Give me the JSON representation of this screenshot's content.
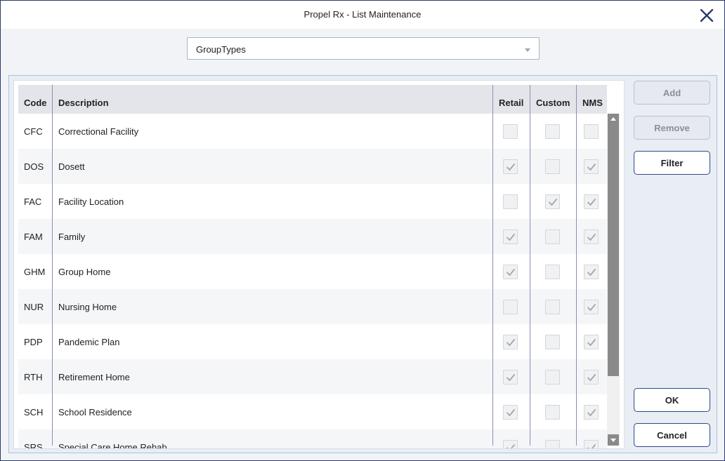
{
  "window": {
    "title": "Propel Rx - List Maintenance"
  },
  "list_selector": {
    "value": "GroupTypes"
  },
  "grid": {
    "columns": [
      "Code",
      "Description",
      "Retail",
      "Custom",
      "NMS"
    ],
    "rows": [
      {
        "code": "CFC",
        "description": "Correctional Facility",
        "retail": false,
        "custom": false,
        "nms": false
      },
      {
        "code": "DOS",
        "description": "Dosett",
        "retail": true,
        "custom": false,
        "nms": true
      },
      {
        "code": "FAC",
        "description": "Facility Location",
        "retail": false,
        "custom": true,
        "nms": true
      },
      {
        "code": "FAM",
        "description": "Family",
        "retail": true,
        "custom": false,
        "nms": true
      },
      {
        "code": "GHM",
        "description": "Group Home",
        "retail": true,
        "custom": false,
        "nms": true
      },
      {
        "code": "NUR",
        "description": "Nursing Home",
        "retail": false,
        "custom": false,
        "nms": true
      },
      {
        "code": "PDP",
        "description": "Pandemic Plan",
        "retail": true,
        "custom": false,
        "nms": true
      },
      {
        "code": "RTH",
        "description": "Retirement Home",
        "retail": true,
        "custom": false,
        "nms": true
      },
      {
        "code": "SCH",
        "description": "School Residence",
        "retail": true,
        "custom": false,
        "nms": true
      },
      {
        "code": "SRS",
        "description": "Special Care Home Rehab",
        "retail": true,
        "custom": false,
        "nms": true
      }
    ]
  },
  "buttons": {
    "add": {
      "label": "Add",
      "enabled": false
    },
    "remove": {
      "label": "Remove",
      "enabled": false
    },
    "filter": {
      "label": "Filter",
      "enabled": true
    },
    "ok": {
      "label": "OK",
      "enabled": true
    },
    "cancel": {
      "label": "Cancel",
      "enabled": true
    }
  }
}
